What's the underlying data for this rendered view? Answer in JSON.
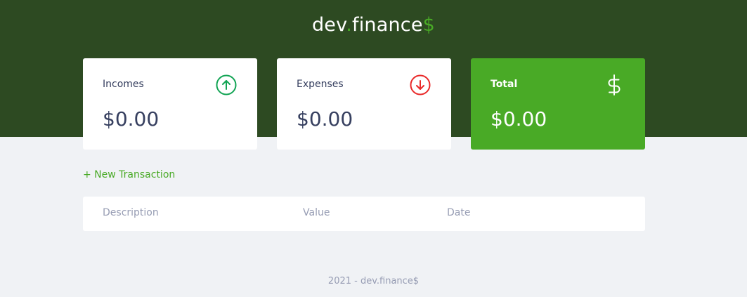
{
  "header": {
    "logo_prefix": "dev",
    "logo_dot": ".",
    "logo_name": "finance",
    "logo_suffix": "$"
  },
  "cards": {
    "incomes": {
      "label": "Incomes",
      "value": "$0.00",
      "icon": "arrow-up-circle-icon"
    },
    "expenses": {
      "label": "Expenses",
      "value": "$0.00",
      "icon": "arrow-down-circle-icon"
    },
    "total": {
      "label": "Total",
      "value": "$0.00",
      "icon": "dollar-sign-icon"
    }
  },
  "actions": {
    "new_transaction": "+ New Transaction"
  },
  "table": {
    "columns": [
      "Description",
      "Value",
      "Date"
    ]
  },
  "footer": {
    "text": "2021 - dev.finance$"
  },
  "colors": {
    "header_bg": "#2d4a22",
    "accent_green": "#49aa26",
    "income_green": "#12a454",
    "expense_red": "#e92929",
    "text_dark": "#363f5f",
    "text_muted": "#969cb3",
    "page_bg": "#f0f2f5"
  }
}
